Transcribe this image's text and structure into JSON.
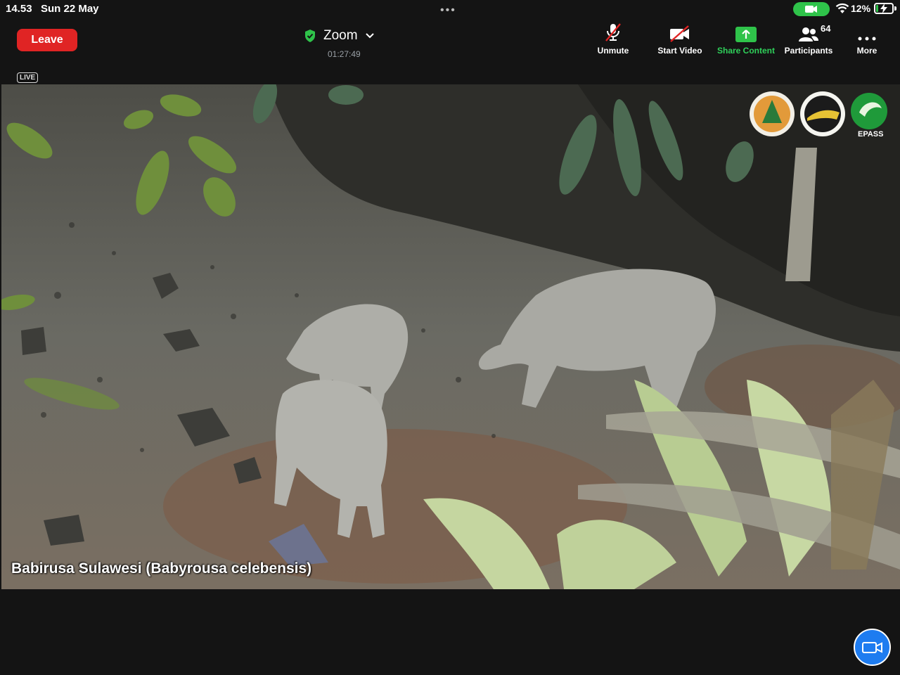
{
  "status_bar": {
    "time": "14.53",
    "date": "Sun 22 May",
    "battery_percent": "12%",
    "battery_level": 0.12
  },
  "toolbar": {
    "leave_label": "Leave",
    "meeting_name": "Zoom",
    "timer": "01:27:49",
    "buttons": [
      {
        "label": "Unmute",
        "icon": "mic-muted-icon"
      },
      {
        "label": "Start Video",
        "icon": "video-off-icon"
      },
      {
        "label": "Share Content",
        "icon": "share-icon"
      },
      {
        "label": "Participants",
        "icon": "participants-icon"
      },
      {
        "label": "More",
        "icon": "more-icon"
      }
    ],
    "participant_count": "64"
  },
  "video": {
    "live_label": "LIVE",
    "caption": "Babirusa Sulawesi (Babyrousa celebensis)",
    "logo_text": "EPASS"
  },
  "colors": {
    "leave": "#e02424",
    "accent_green": "#2fd05a",
    "fab": "#1e7cf0"
  }
}
